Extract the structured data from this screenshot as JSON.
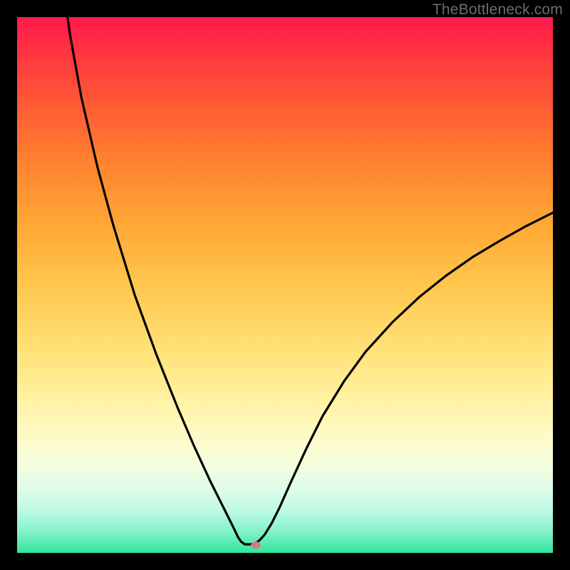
{
  "watermark": "TheBottleneck.com",
  "chart_data": {
    "type": "line",
    "title": "",
    "xlabel": "",
    "ylabel": "",
    "xlim": [
      0,
      100
    ],
    "ylim": [
      0,
      100
    ],
    "curve": [
      {
        "x": 9.4,
        "y": 100.0
      },
      {
        "x": 10.0,
        "y": 96.0
      },
      {
        "x": 12.0,
        "y": 85.0
      },
      {
        "x": 15.0,
        "y": 72.0
      },
      {
        "x": 18.0,
        "y": 61.0
      },
      {
        "x": 22.0,
        "y": 48.0
      },
      {
        "x": 26.0,
        "y": 37.0
      },
      {
        "x": 30.0,
        "y": 27.0
      },
      {
        "x": 33.0,
        "y": 20.0
      },
      {
        "x": 36.0,
        "y": 13.5
      },
      {
        "x": 38.0,
        "y": 9.5
      },
      {
        "x": 39.5,
        "y": 6.5
      },
      {
        "x": 40.5,
        "y": 4.5
      },
      {
        "x": 41.2,
        "y": 3.0
      },
      {
        "x": 41.8,
        "y": 2.1
      },
      {
        "x": 42.5,
        "y": 1.6
      },
      {
        "x": 43.5,
        "y": 1.6
      },
      {
        "x": 44.5,
        "y": 1.8
      },
      {
        "x": 45.3,
        "y": 2.4
      },
      {
        "x": 46.2,
        "y": 3.4
      },
      {
        "x": 47.5,
        "y": 5.5
      },
      {
        "x": 49.0,
        "y": 8.5
      },
      {
        "x": 51.0,
        "y": 13.0
      },
      {
        "x": 54.0,
        "y": 19.5
      },
      {
        "x": 57.0,
        "y": 25.5
      },
      {
        "x": 61.0,
        "y": 32.0
      },
      {
        "x": 65.0,
        "y": 37.5
      },
      {
        "x": 70.0,
        "y": 43.0
      },
      {
        "x": 75.0,
        "y": 47.7
      },
      {
        "x": 80.0,
        "y": 51.7
      },
      {
        "x": 85.0,
        "y": 55.2
      },
      {
        "x": 90.0,
        "y": 58.2
      },
      {
        "x": 95.0,
        "y": 61.0
      },
      {
        "x": 100.0,
        "y": 63.5
      }
    ],
    "marker": {
      "x": 44.5,
      "y": 1.4,
      "color": "#cf7f7a"
    },
    "gradient_stops": [
      {
        "pos": 0.0,
        "color": "#ff1a4d"
      },
      {
        "pos": 0.5,
        "color": "#ffcb54"
      },
      {
        "pos": 0.8,
        "color": "#fcfccf"
      },
      {
        "pos": 1.0,
        "color": "#2fe59d"
      }
    ]
  }
}
